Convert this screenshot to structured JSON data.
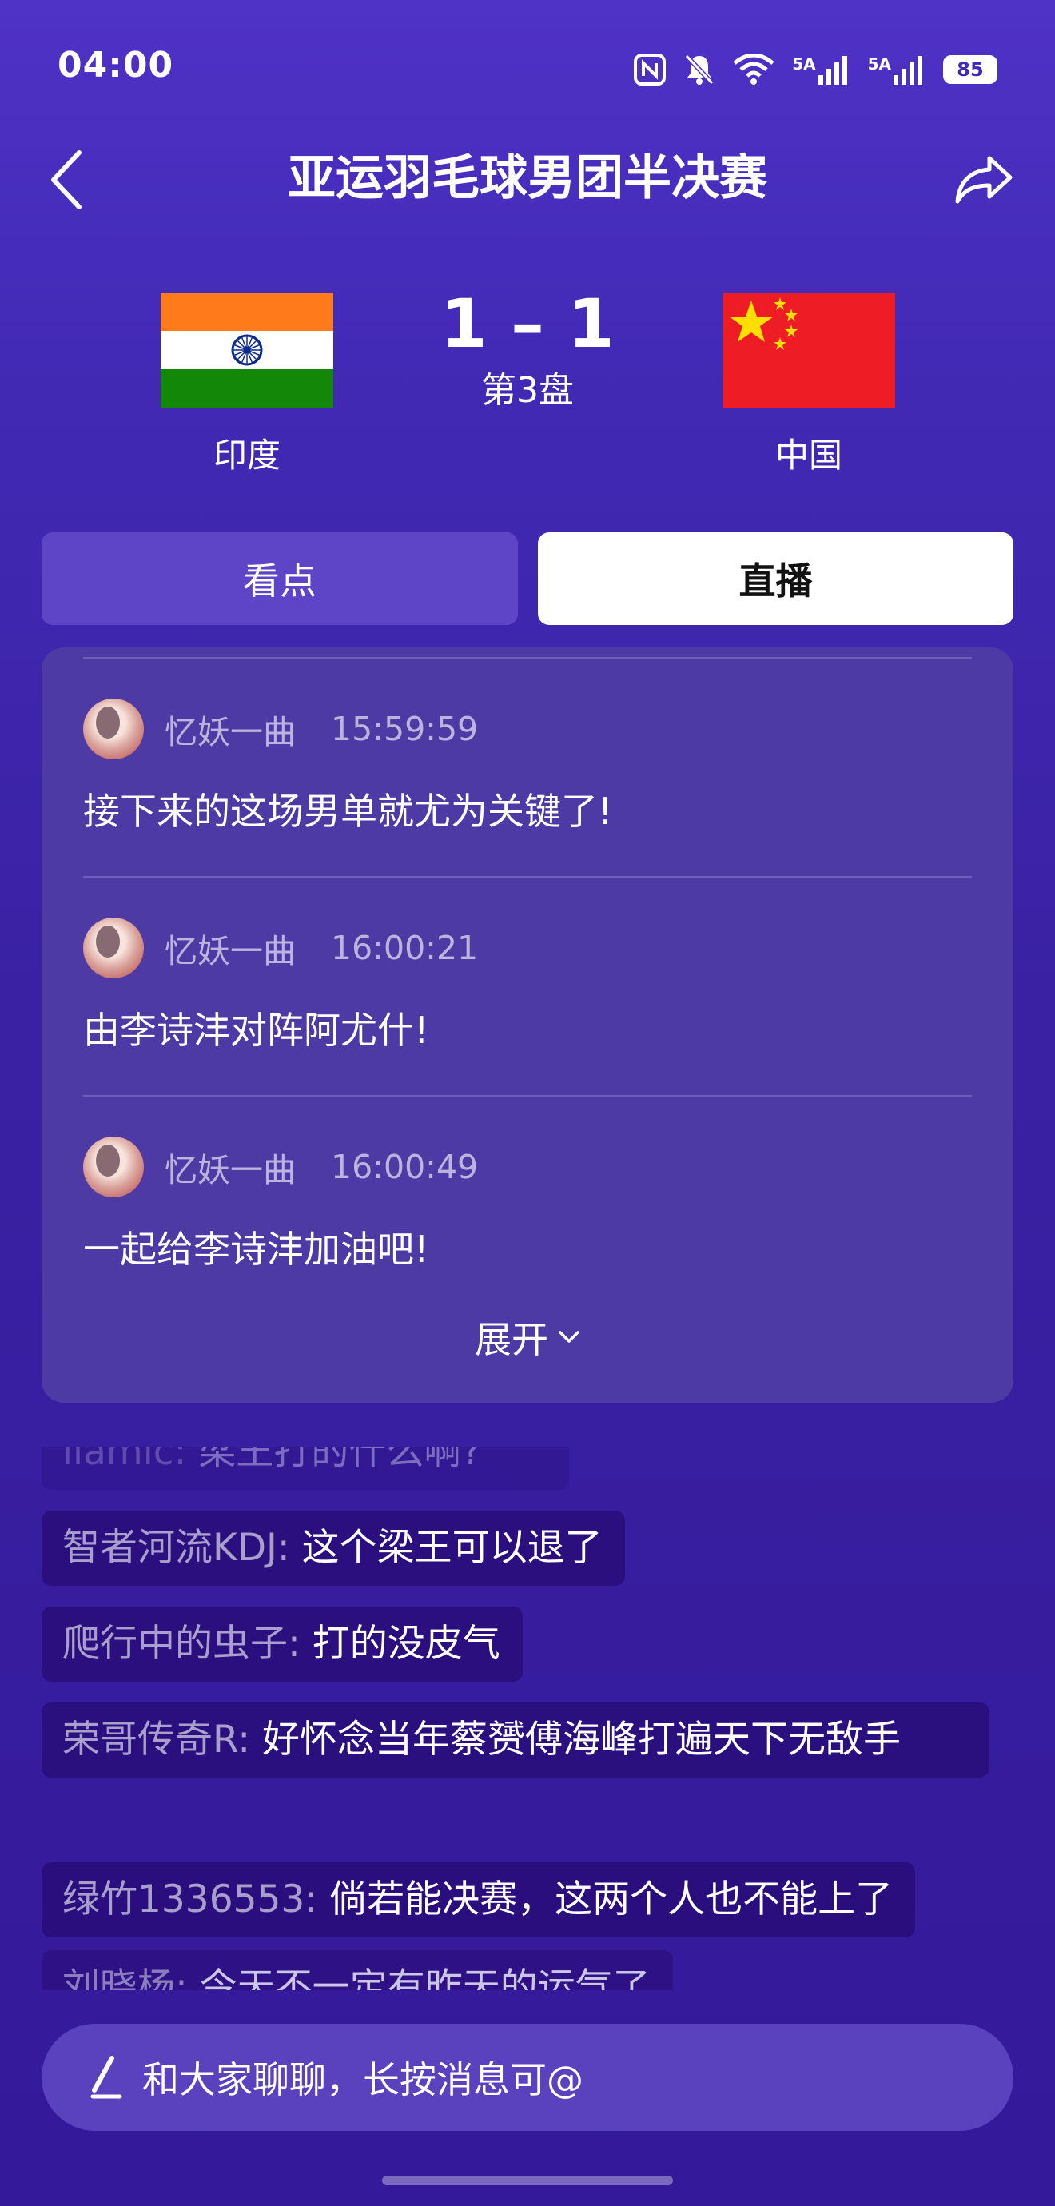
{
  "status_bar": {
    "time": "04:00",
    "battery": "85",
    "signal_label_1": "5A",
    "signal_label_2": "5A"
  },
  "header": {
    "title": "亚运羽毛球男团半决赛"
  },
  "match": {
    "left_team": "印度",
    "right_team": "中国",
    "score": "1 – 1",
    "game": "第3盘"
  },
  "tabs": [
    {
      "label": "看点",
      "active": false
    },
    {
      "label": "直播",
      "active": true
    }
  ],
  "live_messages": [
    {
      "user": "忆妖一曲",
      "time": "15:59:59",
      "text": "接下来的这场男单就尤为关键了!"
    },
    {
      "user": "忆妖一曲",
      "time": "16:00:21",
      "text": "由李诗沣对阵阿尤什!"
    },
    {
      "user": "忆妖一曲",
      "time": "16:00:49",
      "text": "一起给李诗沣加油吧!"
    }
  ],
  "expand_label": "展开",
  "comments": [
    {
      "user": "liamic:",
      "text": "梁王打的什么啊?"
    },
    {
      "user": "智者河流KDJ:",
      "text": "这个梁王可以退了"
    },
    {
      "user": "爬行中的虫子:",
      "text": "打的没皮气"
    },
    {
      "user": "荣哥传奇R:",
      "text": "好怀念当年蔡赟傅海峰打遍天下无敌手"
    },
    {
      "user": "绿竹1336553:",
      "text": "倘若能决赛，这两个人也不能上了"
    },
    {
      "user": "刘晓杨:",
      "text": "今天不一定有昨天的运气了"
    }
  ],
  "input": {
    "placeholder": "和大家聊聊，长按消息可@"
  },
  "colors": {
    "background_top": "#4f32c6",
    "background_bottom": "#34199a",
    "card": "#4e3aa4",
    "india_saffron": "#ff7a1a",
    "india_green": "#138808",
    "china_red": "#ee1c25",
    "china_star": "#ffde00"
  }
}
